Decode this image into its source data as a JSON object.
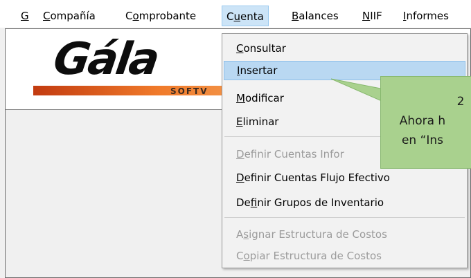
{
  "menubar": {
    "items": [
      {
        "pre": "",
        "key": "G",
        "post": ""
      },
      {
        "pre": "",
        "key": "C",
        "post": "ompañía"
      },
      {
        "pre": "C",
        "key": "o",
        "post": "mprobante"
      },
      {
        "pre": "C",
        "key": "u",
        "post": "enta"
      },
      {
        "pre": "",
        "key": "B",
        "post": "alances"
      },
      {
        "pre": "",
        "key": "N",
        "post": "IIF"
      },
      {
        "pre": "",
        "key": "I",
        "post": "nformes"
      }
    ]
  },
  "logo": {
    "word": "Gála",
    "sub": "SOFTV"
  },
  "dropdown": {
    "items": [
      {
        "pre": "",
        "key": "C",
        "post": "onsultar",
        "disabled": false
      },
      {
        "pre": "",
        "key": "I",
        "post": "nsertar",
        "disabled": false,
        "highlighted": true
      },
      {
        "pre": "",
        "key": "M",
        "post": "odificar",
        "disabled": false
      },
      {
        "pre": "",
        "key": "E",
        "post": "liminar",
        "disabled": false
      },
      {
        "pre": "",
        "key": "D",
        "post": "efinir Cuentas Infor",
        "disabled": true
      },
      {
        "pre": "",
        "key": "D",
        "post": "efinir Cuentas Flujo Efectivo",
        "disabled": false
      },
      {
        "pre": "De",
        "key": "f",
        "post": "inir Grupos de Inventario",
        "disabled": false
      },
      {
        "pre": "A",
        "key": "s",
        "post": "ignar Estructura de Costos",
        "disabled": true
      },
      {
        "pre": "C",
        "key": "o",
        "post": "piar Estructura de Costos",
        "disabled": true
      }
    ]
  },
  "callout": {
    "line1": "2",
    "line2": "Ahora h",
    "line3": "en “Ins"
  },
  "colors": {
    "callout": "#a9d18e",
    "highlight": "#b9d8f2",
    "menu_active": "#cce4f7",
    "logo_orange": "#f07a2a"
  }
}
